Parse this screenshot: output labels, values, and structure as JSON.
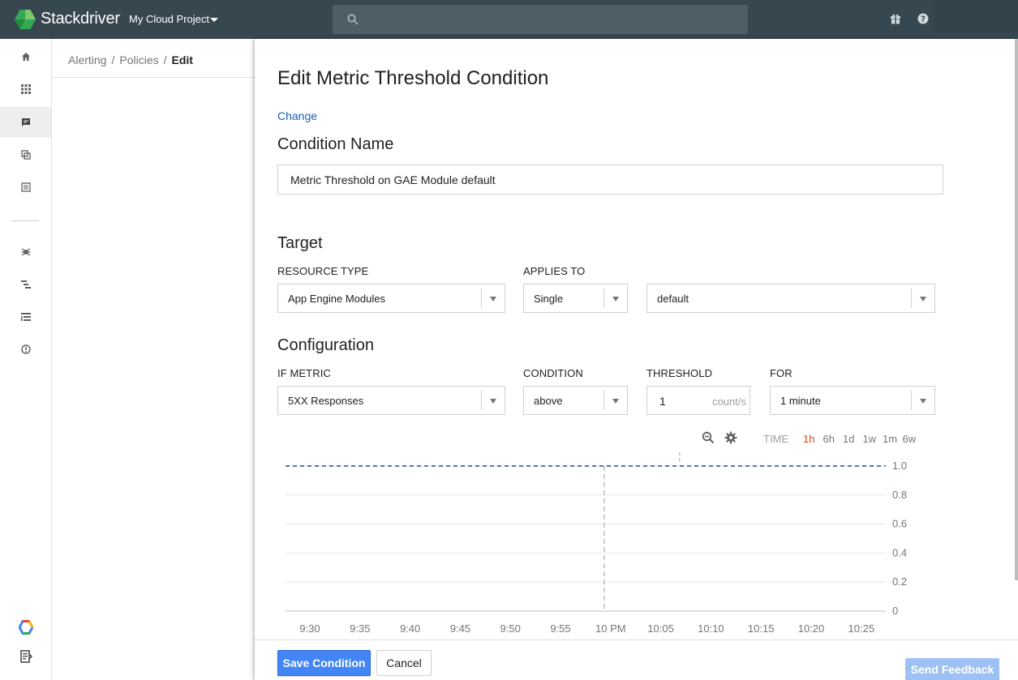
{
  "header": {
    "brand": "Stackdriver",
    "project": "My Cloud Project"
  },
  "breadcrumb": {
    "items": [
      "Alerting",
      "Policies",
      "Edit"
    ]
  },
  "panel": {
    "title": "Edit Metric Threshold Condition",
    "change_link": "Change",
    "condition_name_heading": "Condition Name",
    "condition_name_value": "Metric Threshold on GAE Module default",
    "target_heading": "Target",
    "resource_type_label": "RESOURCE TYPE",
    "resource_type_value": "App Engine Modules",
    "applies_to_label": "APPLIES TO",
    "applies_to_value": "Single",
    "target_value": "default",
    "configuration_heading": "Configuration",
    "if_metric_label": "IF METRIC",
    "if_metric_value": "5XX Responses",
    "condition_label": "CONDITION",
    "condition_value": "above",
    "threshold_label": "THRESHOLD",
    "threshold_value": "1",
    "threshold_unit": "count/s",
    "for_label": "FOR",
    "for_value": "1 minute"
  },
  "chart_toolbar": {
    "time_label": "TIME",
    "ranges": [
      "1h",
      "6h",
      "1d",
      "1w",
      "1m",
      "6w"
    ],
    "active_range": "1h"
  },
  "chart_data": {
    "type": "line",
    "x_ticks": [
      "9:30",
      "9:35",
      "9:40",
      "9:45",
      "9:50",
      "9:55",
      "10 PM",
      "10:05",
      "10:10",
      "10:15",
      "10:20",
      "10:25"
    ],
    "y_ticks": [
      "0",
      "0.2",
      "0.4",
      "0.6",
      "0.8",
      "1.0"
    ],
    "ylim": [
      0,
      1.0
    ],
    "threshold": 1.0,
    "series": [],
    "grid": true,
    "marker_x": "10 PM"
  },
  "footer": {
    "save_label": "Save Condition",
    "cancel_label": "Cancel",
    "feedback_label": "Send Feedback"
  },
  "colors": {
    "topbar": "#37474f",
    "primary": "#4285f4",
    "link": "#1a5fb4",
    "threshold_line": "#1f4e8c",
    "active_range": "#d84315"
  }
}
